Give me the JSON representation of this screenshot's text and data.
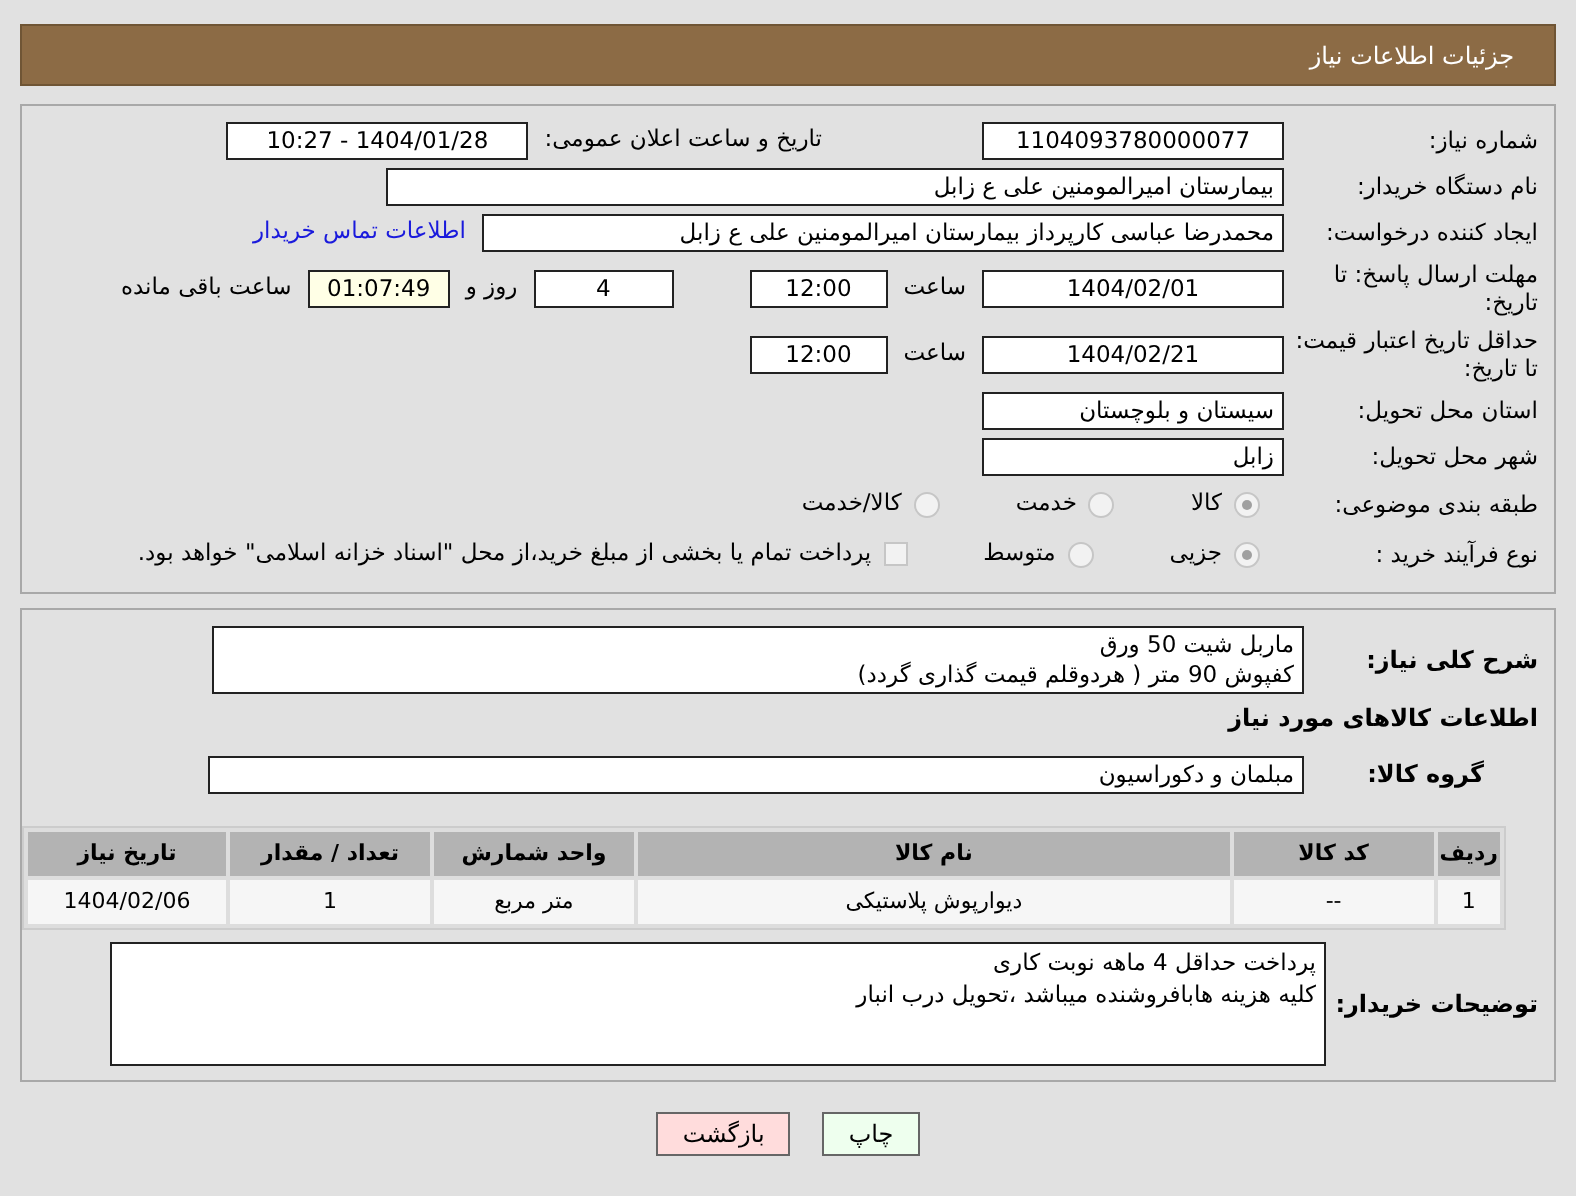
{
  "header": {
    "title": "جزئیات اطلاعات نیاز"
  },
  "need_number": {
    "label": "شماره نیاز:",
    "value": "1104093780000077"
  },
  "announce_datetime": {
    "label": "تاریخ و ساعت اعلان عمومی:",
    "value": "1404/01/28 - 10:27"
  },
  "buyer_org": {
    "label": "نام دستگاه خریدار:",
    "value": "بیمارستان امیرالمومنین علی  ع  زابل"
  },
  "requester": {
    "label": "ایجاد کننده درخواست:",
    "value": "محمدرضا عباسی کارپرداز بیمارستان امیرالمومنین علی  ع  زابل",
    "contact_link": "اطلاعات تماس خریدار"
  },
  "response_deadline": {
    "label": "مهلت ارسال پاسخ: تا تاریخ:",
    "date": "1404/02/01",
    "time_label": "ساعت",
    "time": "12:00",
    "days": "4",
    "days_label": "روز و",
    "remaining": "01:07:49",
    "remaining_label": "ساعت باقی مانده"
  },
  "price_validity": {
    "label": "حداقل تاریخ اعتبار قیمت: تا تاریخ:",
    "date": "1404/02/21",
    "time_label": "ساعت",
    "time": "12:00"
  },
  "province": {
    "label": "استان محل تحویل:",
    "value": "سیستان و بلوچستان"
  },
  "city": {
    "label": "شهر محل تحویل:",
    "value": "زابل"
  },
  "category": {
    "label": "طبقه بندی موضوعی:",
    "options": [
      {
        "label": "کالا",
        "selected": true
      },
      {
        "label": "خدمت",
        "selected": false
      },
      {
        "label": "کالا/خدمت",
        "selected": false
      }
    ]
  },
  "purchase_process": {
    "label": "نوع فرآیند خرید :",
    "options": [
      {
        "label": "جزیی",
        "selected": true
      },
      {
        "label": "متوسط",
        "selected": false
      }
    ],
    "payment_note": {
      "label": "پرداخت تمام یا بخشی از مبلغ خرید،از محل \"اسناد خزانه اسلامی\" خواهد بود.",
      "checked": false
    }
  },
  "description": {
    "label": "شرح کلی نیاز:",
    "lines": [
      "ماربل شیت  50 ورق",
      "کفپوش  90 متر ( هردوقلم قیمت گذاری گردد)"
    ]
  },
  "goods_heading": "اطلاعات کالاهای مورد نیاز",
  "goods_group": {
    "label": "گروه کالا:",
    "value": "مبلمان و دکوراسیون"
  },
  "table": {
    "columns": [
      "ردیف",
      "کد کالا",
      "نام کالا",
      "واحد شمارش",
      "تعداد / مقدار",
      "تاریخ نیاز"
    ],
    "rows": [
      [
        "1",
        "--",
        "دیوارپوش پلاستیکی",
        "متر مربع",
        "1",
        "1404/02/06"
      ]
    ]
  },
  "buyer_notes": {
    "label": "توضیحات خریدار:",
    "lines": [
      "پرداخت حداقل 4 ماهه نوبت کاری",
      "کلیه هزینه هابافروشنده میباشد ،تحویل درب انبار"
    ]
  },
  "buttons": [
    {
      "label": "چاپ",
      "kind": "print"
    },
    {
      "label": "بازگشت",
      "kind": "back"
    }
  ]
}
